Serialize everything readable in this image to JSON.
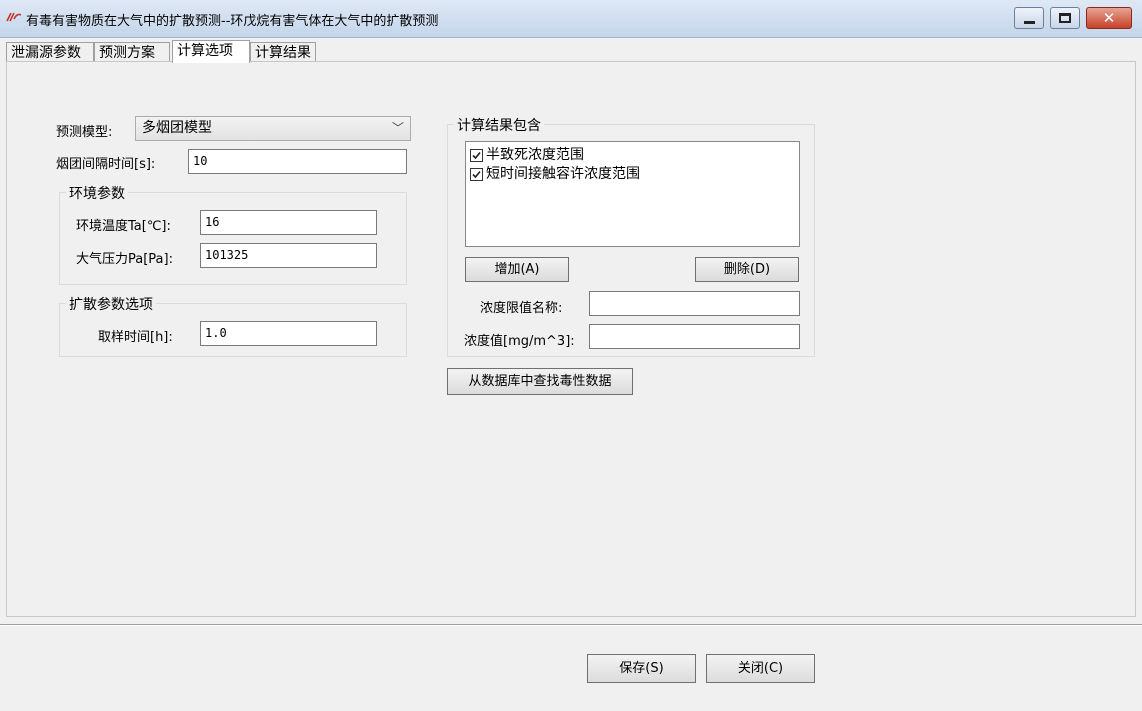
{
  "window": {
    "title": "有毒有害物质在大气中的扩散预测--环戊烷有害气体在大气中的扩散预测",
    "icon": "app-logo-icon"
  },
  "tabs": [
    {
      "label": "泄漏源参数",
      "active": false
    },
    {
      "label": "预测方案",
      "active": false
    },
    {
      "label": "计算选项",
      "active": true
    },
    {
      "label": "计算结果",
      "active": false
    }
  ],
  "form": {
    "model_label": "预测模型:",
    "model_value": "多烟团模型",
    "interval_label": "烟团间隔时间[s]:",
    "interval_value": "10",
    "env_group_title": "环境参数",
    "temp_label": "环境温度Ta[℃]:",
    "temp_value": "16",
    "pressure_label": "大气压力Pa[Pa]:",
    "pressure_value": "101325",
    "diffusion_group_title": "扩散参数选项",
    "sampling_label": "取样时间[h]:",
    "sampling_value": "1.0"
  },
  "results": {
    "group_title": "计算结果包含",
    "items": [
      {
        "label": "半致死浓度范围",
        "checked": true
      },
      {
        "label": "短时间接触容许浓度范围",
        "checked": true
      }
    ],
    "add_button": "增加(A)",
    "delete_button": "删除(D)",
    "limit_name_label": "浓度限值名称:",
    "limit_name_value": "",
    "conc_label": "浓度值[mg/m^3]:",
    "conc_value": "",
    "lookup_button": "从数据库中查找毒性数据"
  },
  "footer": {
    "save_button": "保存(S)",
    "close_button": "关闭(C)"
  }
}
